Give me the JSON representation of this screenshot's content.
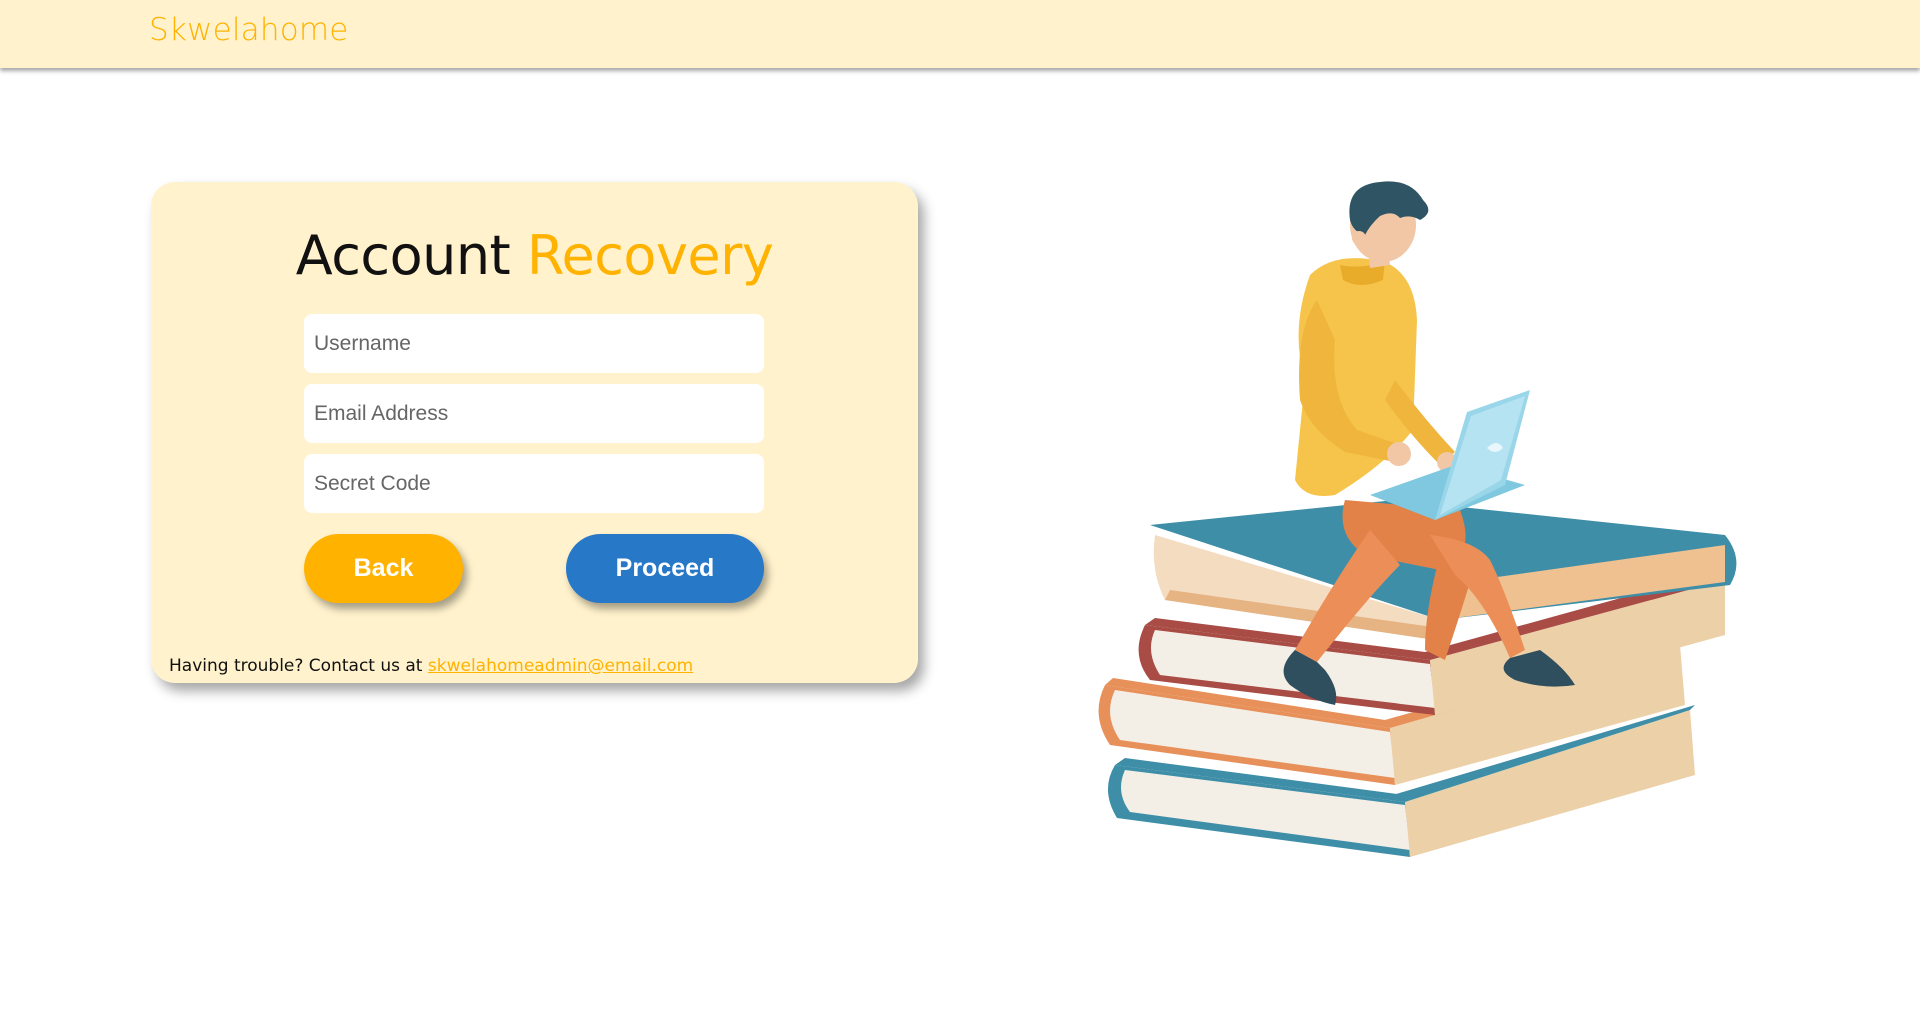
{
  "navbar": {
    "brand": "Skwelahome"
  },
  "card": {
    "title_part1": "Account",
    "title_part2": "Recovery",
    "fields": {
      "username_placeholder": "Username",
      "email_placeholder": "Email Address",
      "secret_placeholder": "Secret Code"
    },
    "buttons": {
      "back_label": "Back",
      "proceed_label": "Proceed"
    },
    "help_text": "Having trouble? Contact us at",
    "help_email": "skwelahomeadmin@email.com"
  },
  "colors": {
    "accent": "#ffb300",
    "card_background": "#fff2cc",
    "primary_button": "#2878c8"
  }
}
